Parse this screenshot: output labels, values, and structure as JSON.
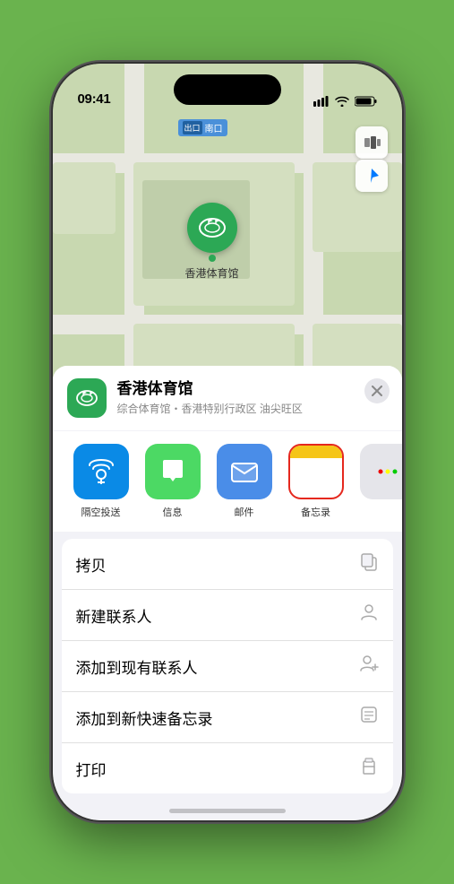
{
  "phone": {
    "time": "09:41",
    "map_label": "南口",
    "stadium": {
      "name": "香港体育馆",
      "subtitle": "综合体育馆・香港特别行政区 油尖旺区"
    },
    "share_items": [
      {
        "id": "airdrop",
        "label": "隔空投送",
        "type": "airplay"
      },
      {
        "id": "messages",
        "label": "信息",
        "type": "messages"
      },
      {
        "id": "mail",
        "label": "邮件",
        "type": "mail"
      },
      {
        "id": "notes",
        "label": "备忘录",
        "type": "notes"
      }
    ],
    "actions": [
      {
        "id": "copy",
        "label": "拷贝",
        "icon": "copy"
      },
      {
        "id": "new-contact",
        "label": "新建联系人",
        "icon": "person"
      },
      {
        "id": "add-existing",
        "label": "添加到现有联系人",
        "icon": "person-add"
      },
      {
        "id": "add-note",
        "label": "添加到新快速备忘录",
        "icon": "note"
      },
      {
        "id": "print",
        "label": "打印",
        "icon": "printer"
      }
    ]
  }
}
